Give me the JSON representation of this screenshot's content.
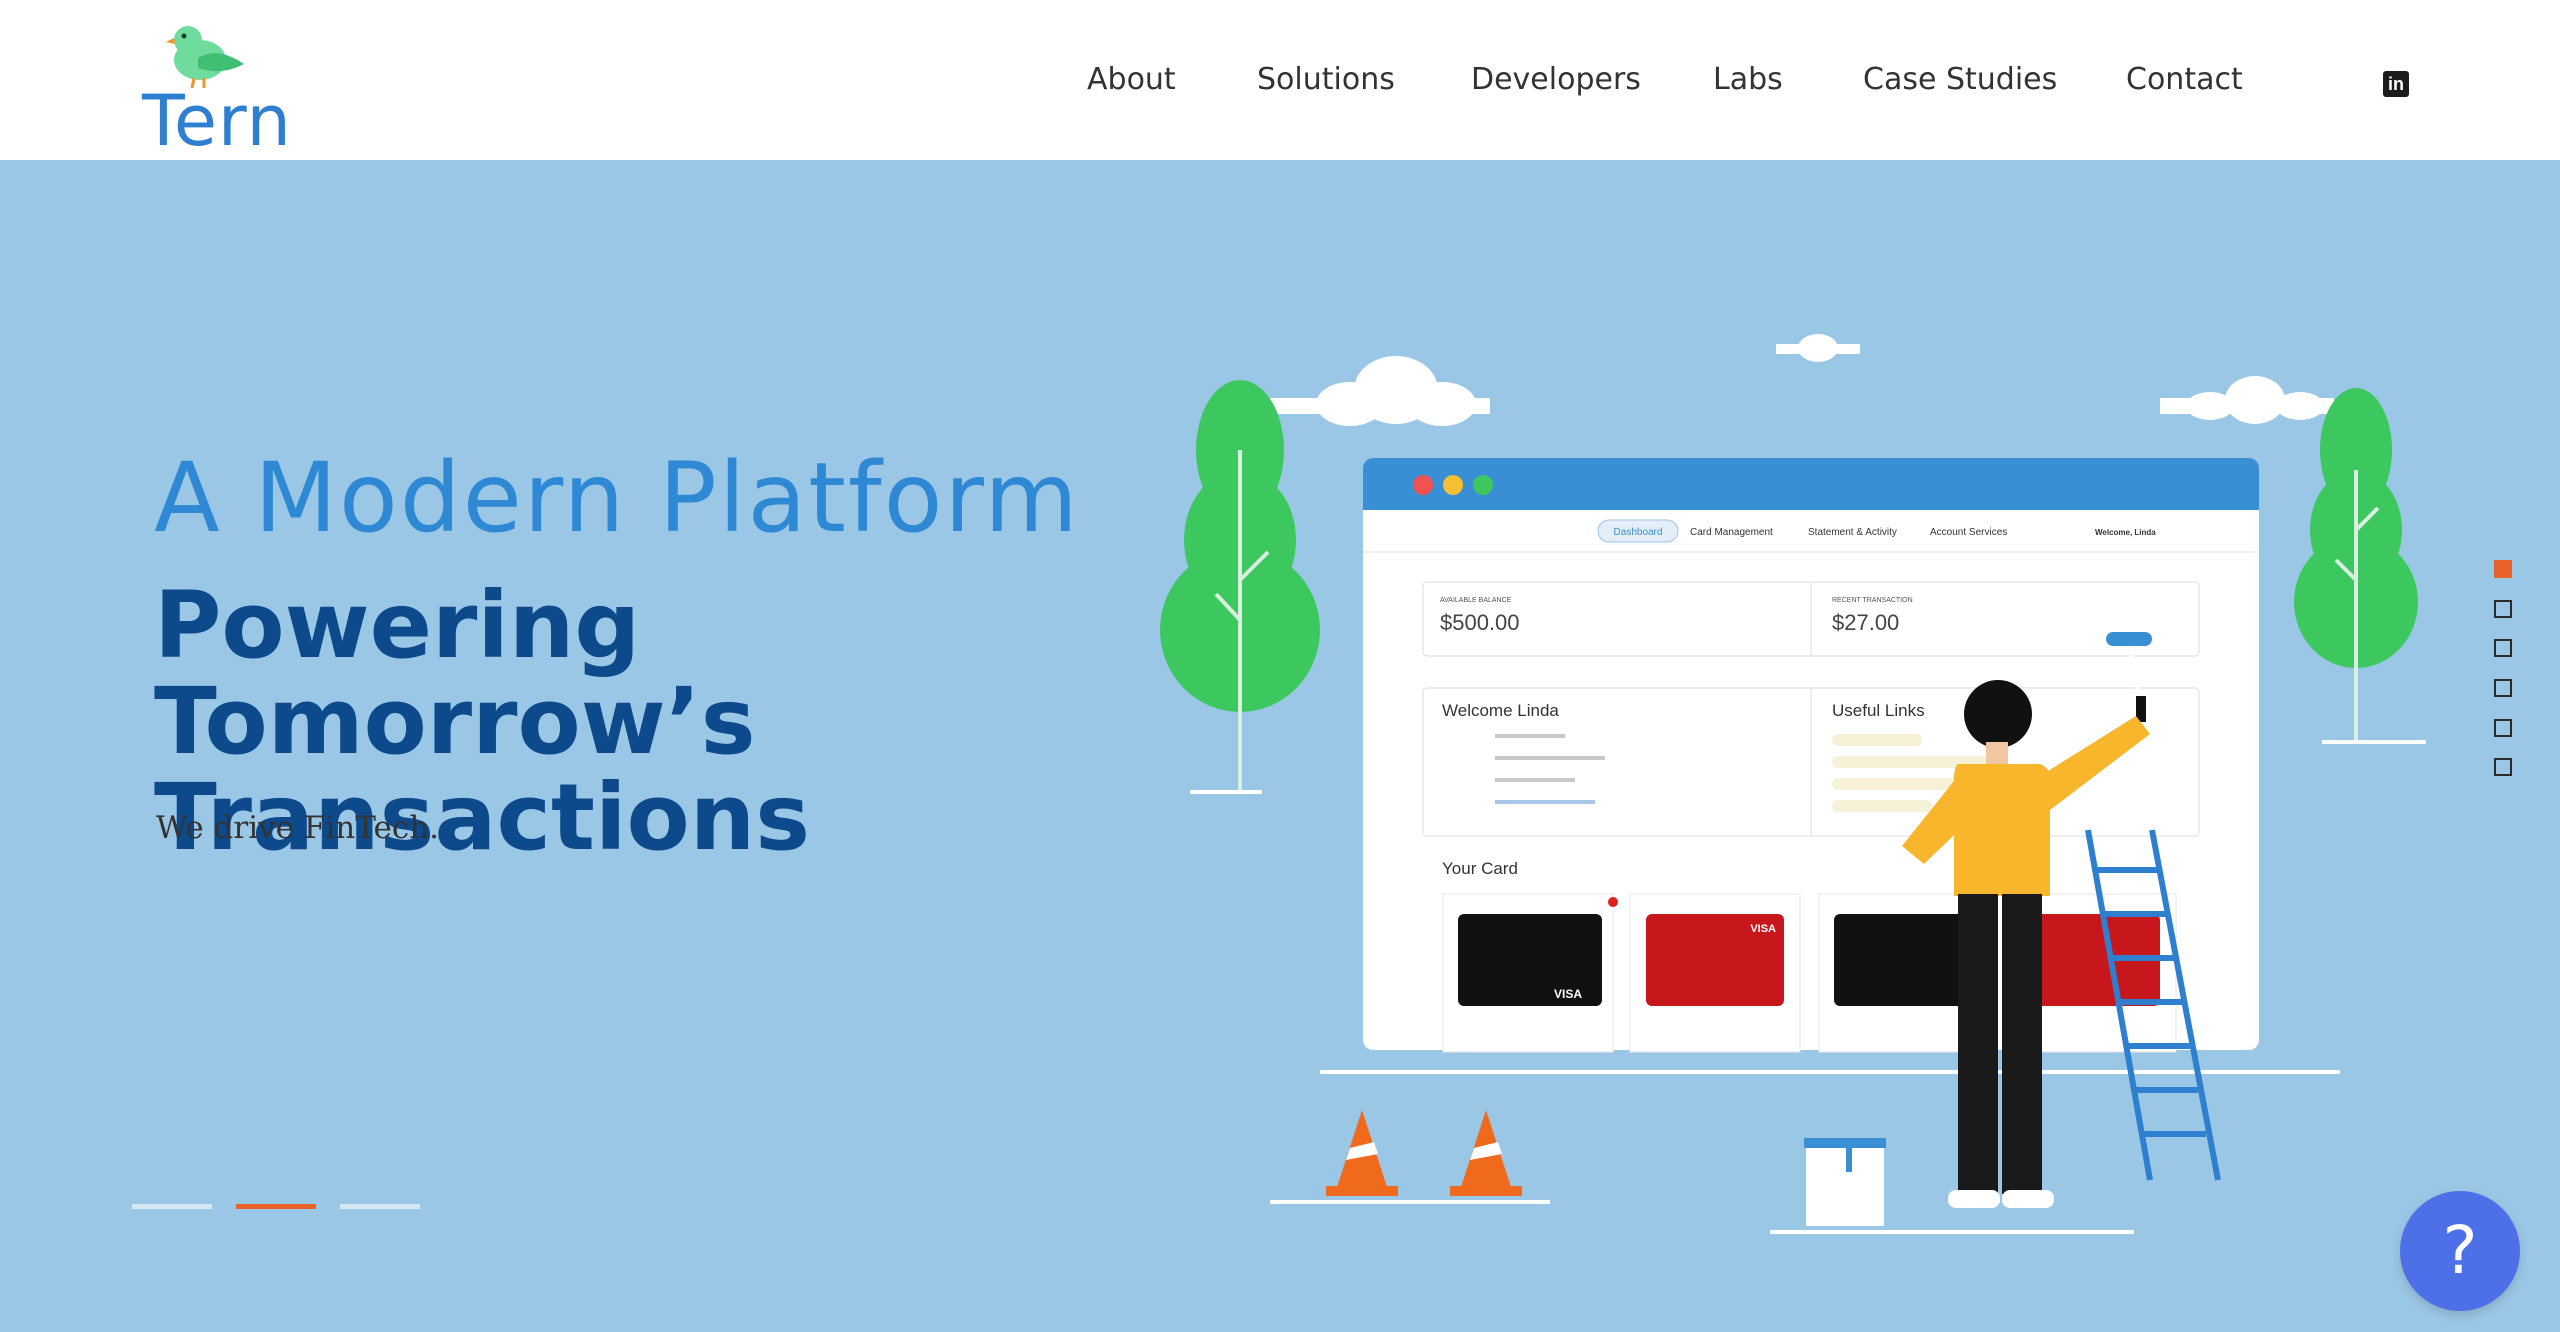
{
  "brand": {
    "name": "Tern"
  },
  "nav": {
    "items": [
      {
        "label": "About"
      },
      {
        "label": "Solutions"
      },
      {
        "label": "Developers"
      },
      {
        "label": "Labs"
      },
      {
        "label": "Case Studies"
      },
      {
        "label": "Contact"
      }
    ],
    "social_icon": "linkedin-icon",
    "social_letters": "in"
  },
  "hero": {
    "headline_light": "A Modern Platform",
    "headline_bold": "Powering Tomorrow’s Transactions",
    "subheadline": "We drive FinTech.",
    "active_slide": 2,
    "slide_count": 3,
    "section_count": 6,
    "active_section": 1
  },
  "mock_dashboard": {
    "tabs": [
      "Dashboard",
      "Card Management",
      "Statement & Activity",
      "Account Services"
    ],
    "welcome_short": "Welcome, Linda",
    "available_balance_label": "AVAILABLE BALANCE",
    "available_balance": "$500.00",
    "recent_transaction_label": "RECENT TRANSACTION",
    "recent_transaction": "$27.00",
    "welcome_title": "Welcome Linda",
    "useful_links_title": "Useful Links",
    "your_card_title": "Your Card",
    "card_brand": "VISA"
  },
  "help": {
    "label": "?"
  },
  "colors": {
    "hero_bg": "#9bc7e6",
    "headline_light": "#2f88d4",
    "headline_bold": "#0d4a8c",
    "accent": "#e8622a",
    "help_button": "#4d6fe8",
    "tree_green": "#3dc85f"
  }
}
